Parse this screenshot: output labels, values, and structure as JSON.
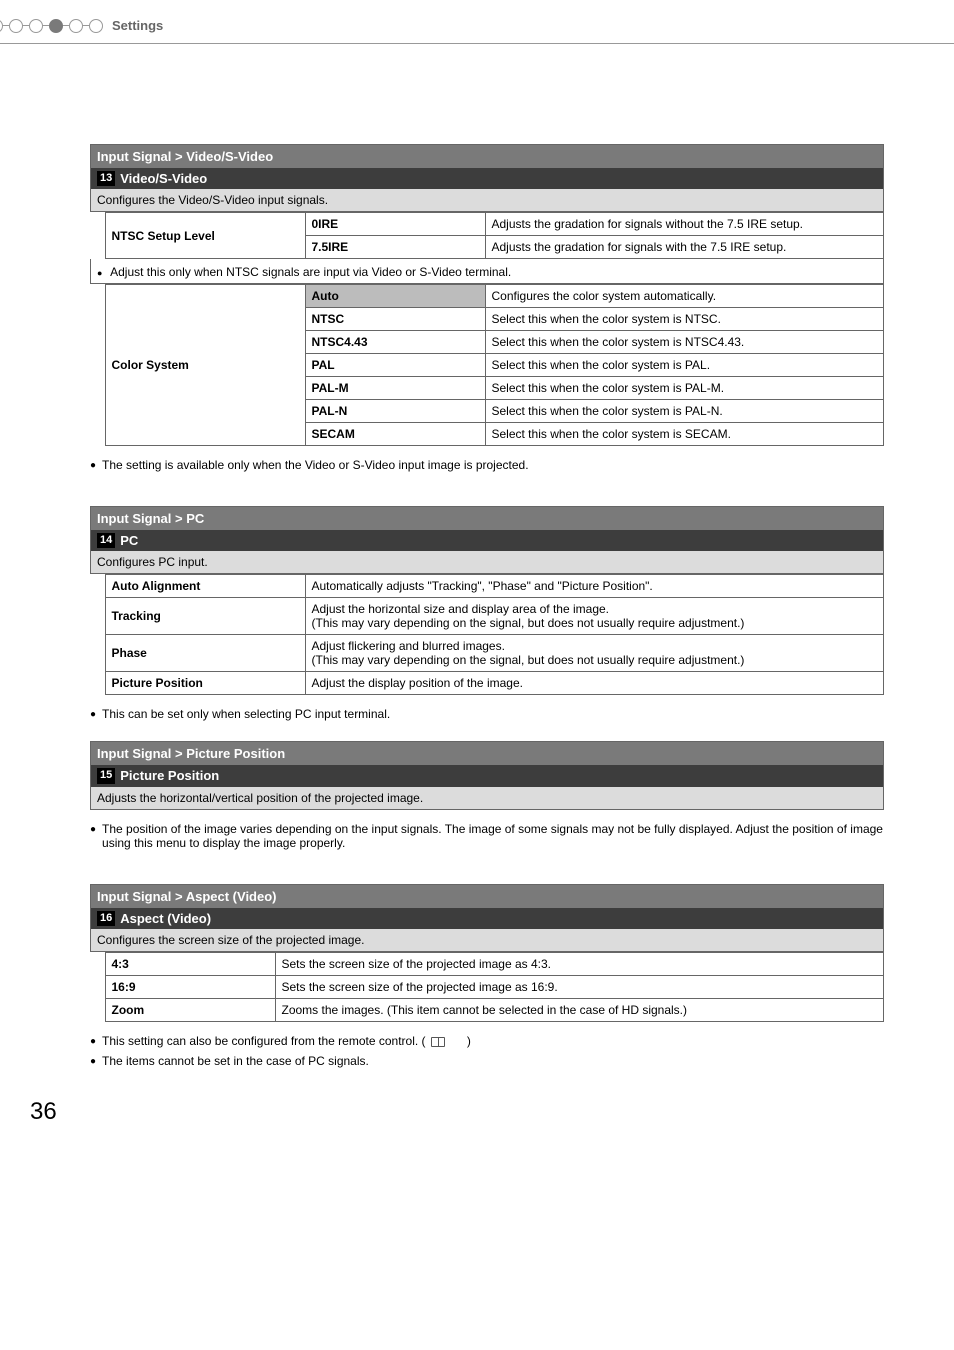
{
  "header": {
    "label": "Settings"
  },
  "section1": {
    "header": "Input Signal > Video/S-Video",
    "sub_num": "13",
    "sub_title": "Video/S-Video",
    "desc": "Configures the Video/S-Video input signals.",
    "ntsc": {
      "label": "NTSC Setup Level",
      "r1o": "0IRE",
      "r1d": "Adjusts the gradation for signals without the 7.5 IRE setup.",
      "r2o": "7.5IRE",
      "r2d": "Adjusts the gradation for signals with the 7.5 IRE setup."
    },
    "inner_note": "Adjust this only when NTSC signals are input via Video or S-Video terminal.",
    "cs": {
      "label": "Color System",
      "r1o": "Auto",
      "r1d": "Configures the color system automatically.",
      "r2o": "NTSC",
      "r2d": "Select this when the color system is NTSC.",
      "r3o": "NTSC4.43",
      "r3d": "Select this when the color system is NTSC4.43.",
      "r4o": "PAL",
      "r4d": "Select this when the color system is PAL.",
      "r5o": "PAL-M",
      "r5d": "Select this when the color system is PAL-M.",
      "r6o": "PAL-N",
      "r6d": "Select this when the color system is PAL-N.",
      "r7o": "SECAM",
      "r7d": "Select this when the color system is SECAM."
    },
    "note": "The setting is available only when the Video or S-Video input image is projected."
  },
  "section2": {
    "header": "Input Signal > PC",
    "sub_num": "14",
    "sub_title": "PC",
    "desc": "Configures PC input.",
    "r1l": "Auto Alignment",
    "r1d": "Automatically adjusts \"Tracking\", \"Phase\" and \"Picture Position\".",
    "r2l": "Tracking",
    "r2d": "Adjust the horizontal size and display area of the image.\n(This may vary depending on the signal, but does not usually require adjustment.)",
    "r3l": "Phase",
    "r3d": "Adjust flickering and blurred images.\n(This may vary depending on the signal, but does not usually require adjustment.)",
    "r4l": "Picture Position",
    "r4d": "Adjust the display position of the image.",
    "note": "This can be set only when selecting PC input terminal."
  },
  "section3": {
    "header": "Input Signal > Picture Position",
    "sub_num": "15",
    "sub_title": "Picture Position",
    "desc": "Adjusts the horizontal/vertical position of the projected image.",
    "note": "The position of the image varies depending on the input signals. The image of some signals may not be fully displayed. Adjust the position of image using this menu to display the image properly."
  },
  "section4": {
    "header": "Input Signal > Aspect (Video)",
    "sub_num": "16",
    "sub_title": "Aspect (Video)",
    "desc": "Configures the screen size of the projected image.",
    "r1l": "4:3",
    "r1d": "Sets the screen size of the projected image as 4:3.",
    "r2l": "16:9",
    "r2d": "Sets the screen size of the projected image as 16:9.",
    "r3l": "Zoom",
    "r3d": "Zooms the images. (This item cannot be selected in the case of HD signals.)",
    "note1a": "This setting can also be configured from the remote control. (",
    "note1b": ")",
    "note2": "The items cannot be set in the case of PC signals."
  },
  "page": "36"
}
